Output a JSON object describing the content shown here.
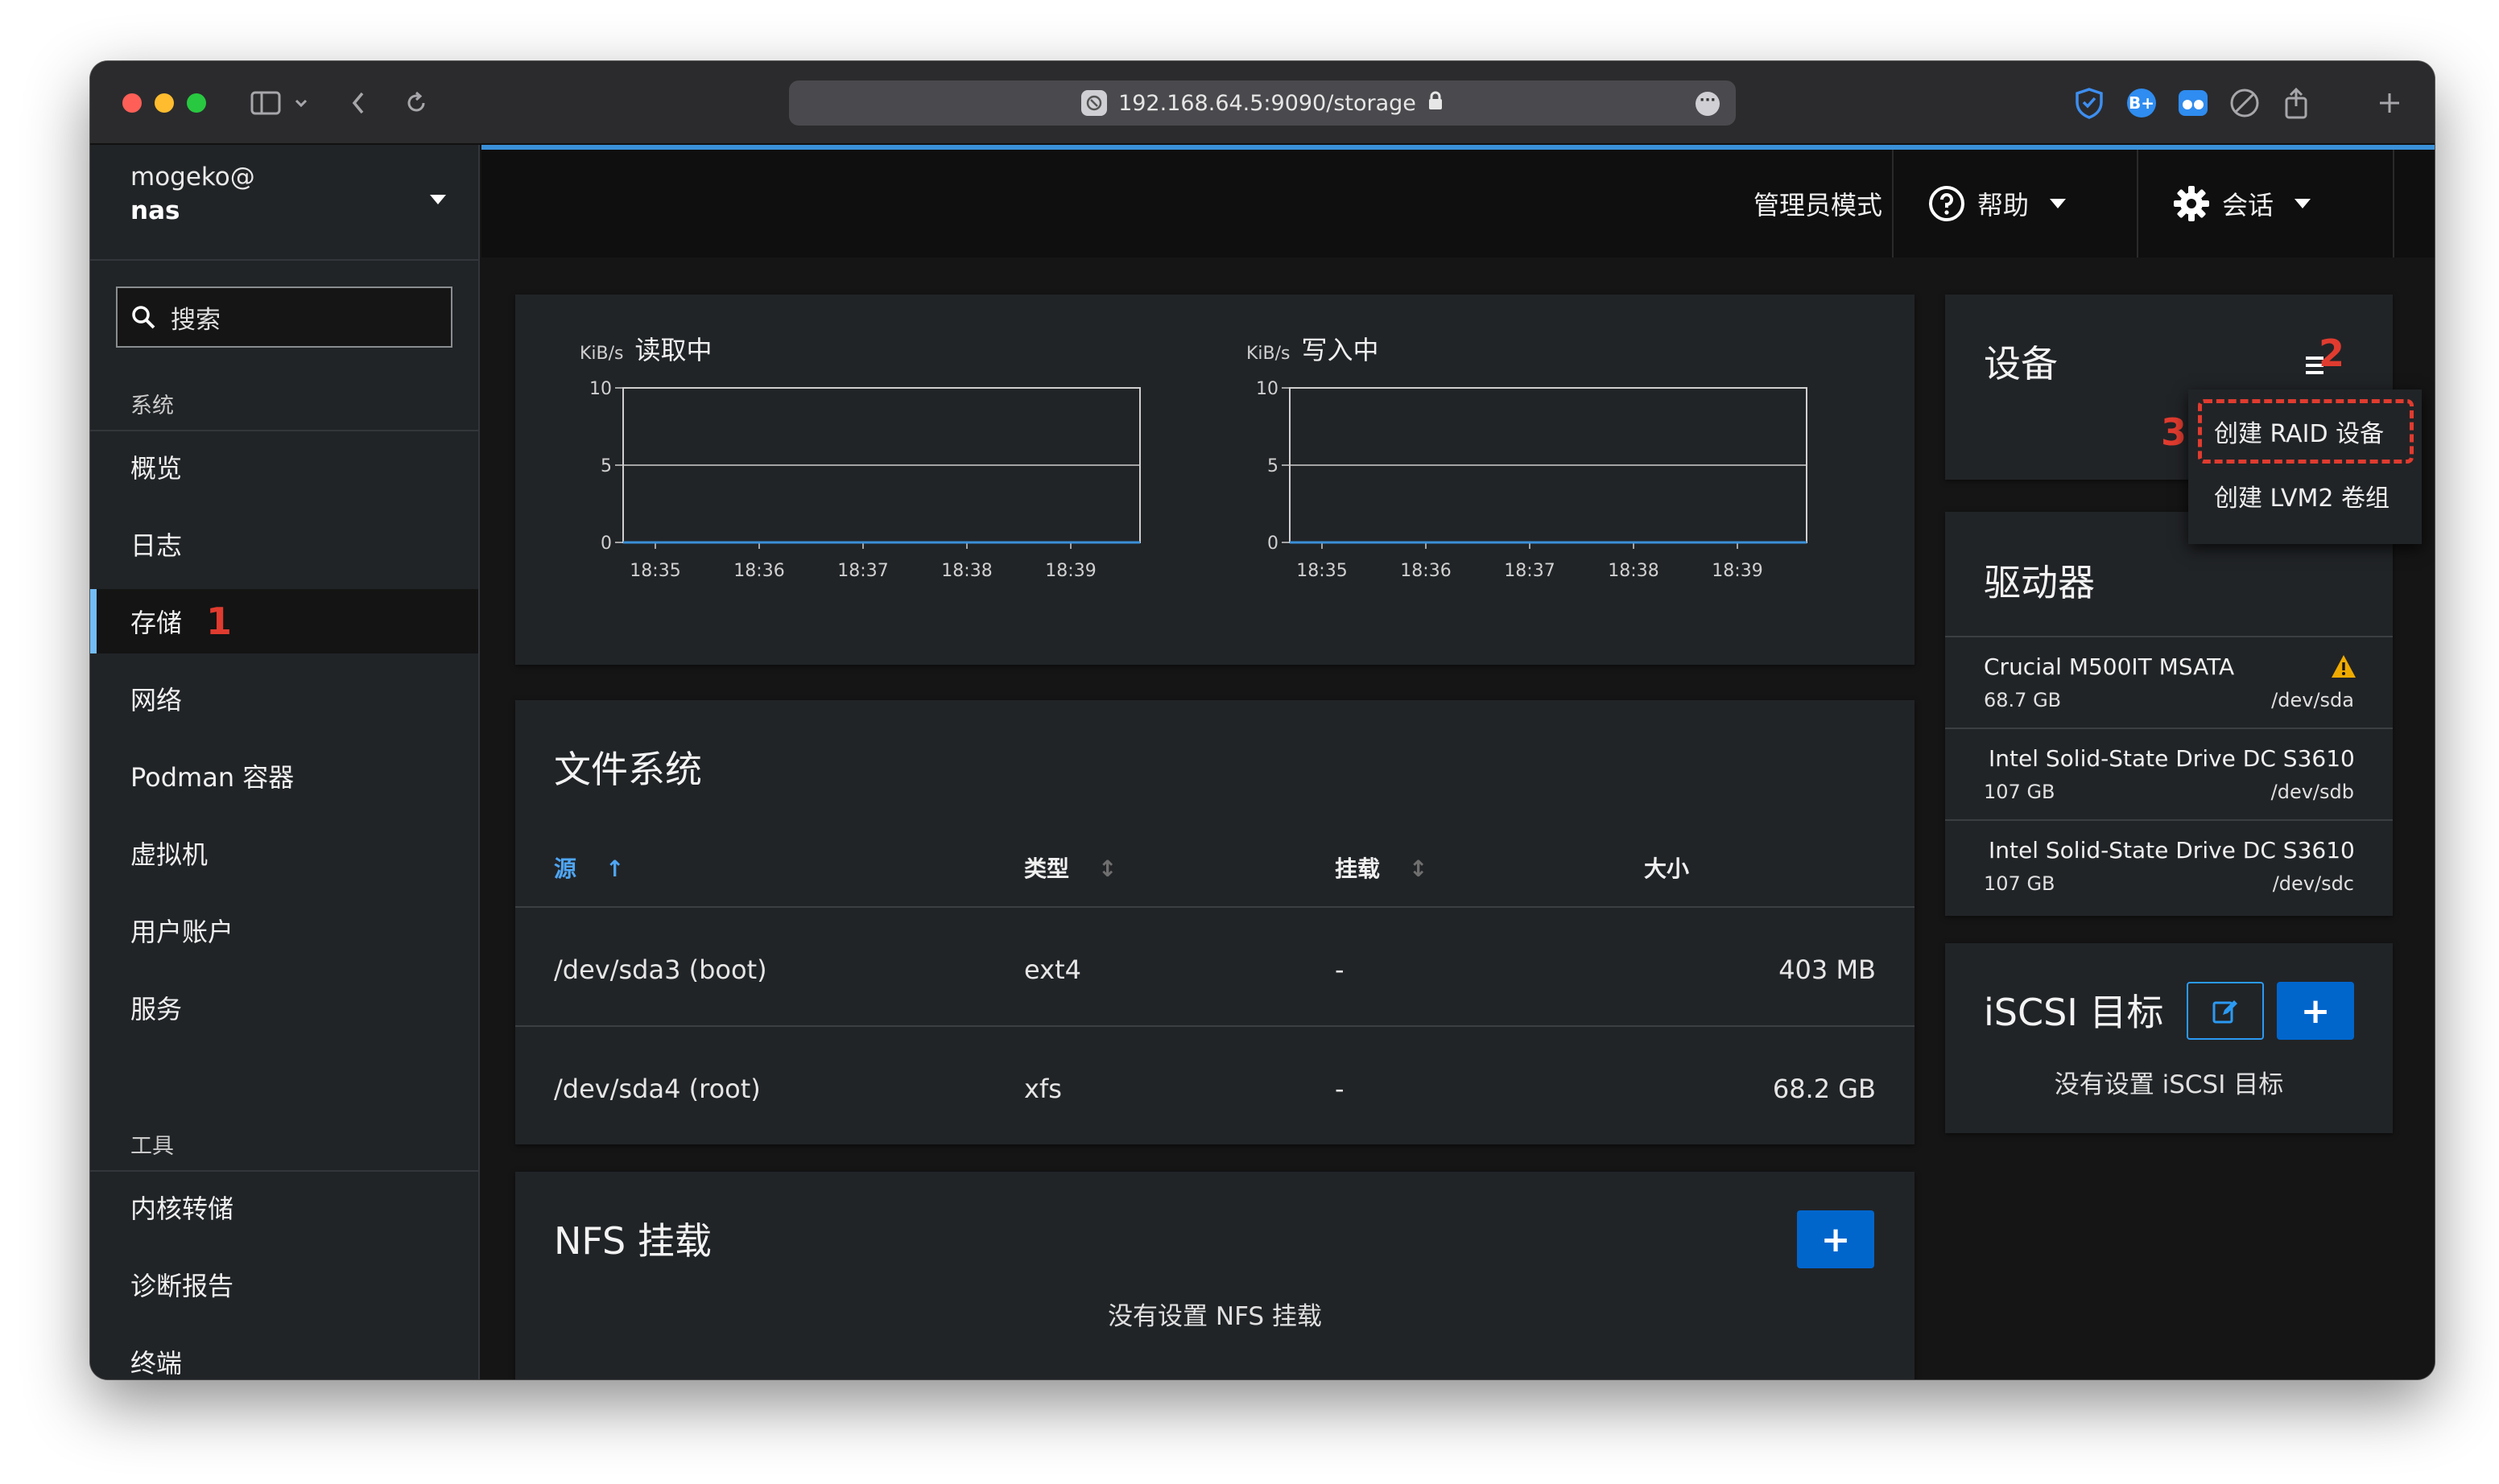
{
  "browser": {
    "url": "192.168.64.5:9090/storage"
  },
  "sidebar": {
    "user": "mogeko@",
    "host": "nas",
    "search_placeholder": "搜索",
    "section_system": "系统",
    "section_tools": "工具",
    "items": [
      {
        "label": "概览"
      },
      {
        "label": "日志"
      },
      {
        "label": "存储",
        "active": true,
        "annotation": "1"
      },
      {
        "label": "网络"
      },
      {
        "label": "Podman 容器"
      },
      {
        "label": "虚拟机"
      },
      {
        "label": "用户账户"
      },
      {
        "label": "服务"
      }
    ],
    "tool_items": [
      {
        "label": "内核转储"
      },
      {
        "label": "诊断报告"
      },
      {
        "label": "终端"
      }
    ]
  },
  "topbar": {
    "admin_mode": "管理员模式",
    "help": "帮助",
    "session": "会话"
  },
  "charts": {
    "read": {
      "unit": "KiB/s",
      "title": "读取中"
    },
    "write": {
      "unit": "KiB/s",
      "title": "写入中"
    }
  },
  "chart_data": [
    {
      "type": "line",
      "title": "读取中",
      "ylabel": "KiB/s",
      "ylim": [
        0,
        10
      ],
      "yticks": [
        "10",
        "5",
        "0"
      ],
      "categories": [
        "18:35",
        "18:36",
        "18:37",
        "18:38",
        "18:39"
      ],
      "values": [
        0,
        0,
        0,
        0,
        0
      ],
      "grid": true
    },
    {
      "type": "line",
      "title": "写入中",
      "ylabel": "KiB/s",
      "ylim": [
        0,
        10
      ],
      "yticks": [
        "10",
        "5",
        "0"
      ],
      "categories": [
        "18:35",
        "18:36",
        "18:37",
        "18:38",
        "18:39"
      ],
      "values": [
        0,
        0,
        0,
        0,
        0
      ],
      "grid": true
    }
  ],
  "filesystems": {
    "title": "文件系统",
    "headers": {
      "source": "源",
      "type": "类型",
      "mount": "挂载",
      "size": "大小"
    },
    "rows": [
      {
        "source": "/dev/sda3 (boot)",
        "type": "ext4",
        "mount": "-",
        "size": "403 MB"
      },
      {
        "source": "/dev/sda4 (root)",
        "type": "xfs",
        "mount": "-",
        "size": "68.2 GB"
      }
    ]
  },
  "nfs": {
    "title": "NFS 挂载",
    "add_label": "+",
    "empty": "没有设置 NFS 挂载"
  },
  "devices": {
    "title": "设备",
    "annotation_menu": "2",
    "annotation_item": "3",
    "menu": [
      {
        "label": "创建 RAID 设备",
        "highlighted": true
      },
      {
        "label": "创建 LVM2 卷组"
      }
    ]
  },
  "drives": {
    "title": "驱动器",
    "items": [
      {
        "name": "Crucial M500IT MSATA",
        "size": "68.7 GB",
        "dev": "/dev/sda",
        "warning": true
      },
      {
        "name": "Intel Solid-State Drive DC S3610",
        "size": "107 GB",
        "dev": "/dev/sdb"
      },
      {
        "name": "Intel Solid-State Drive DC S3610",
        "size": "107 GB",
        "dev": "/dev/sdc"
      }
    ]
  },
  "iscsi": {
    "title": "iSCSI 目标",
    "add_label": "+",
    "empty": "没有设置 iSCSI 目标"
  },
  "colors": {
    "accent": "#3a90d8",
    "primary_button": "#0066cc",
    "annotation": "#e03b2f",
    "warning": "#f0ab00"
  }
}
